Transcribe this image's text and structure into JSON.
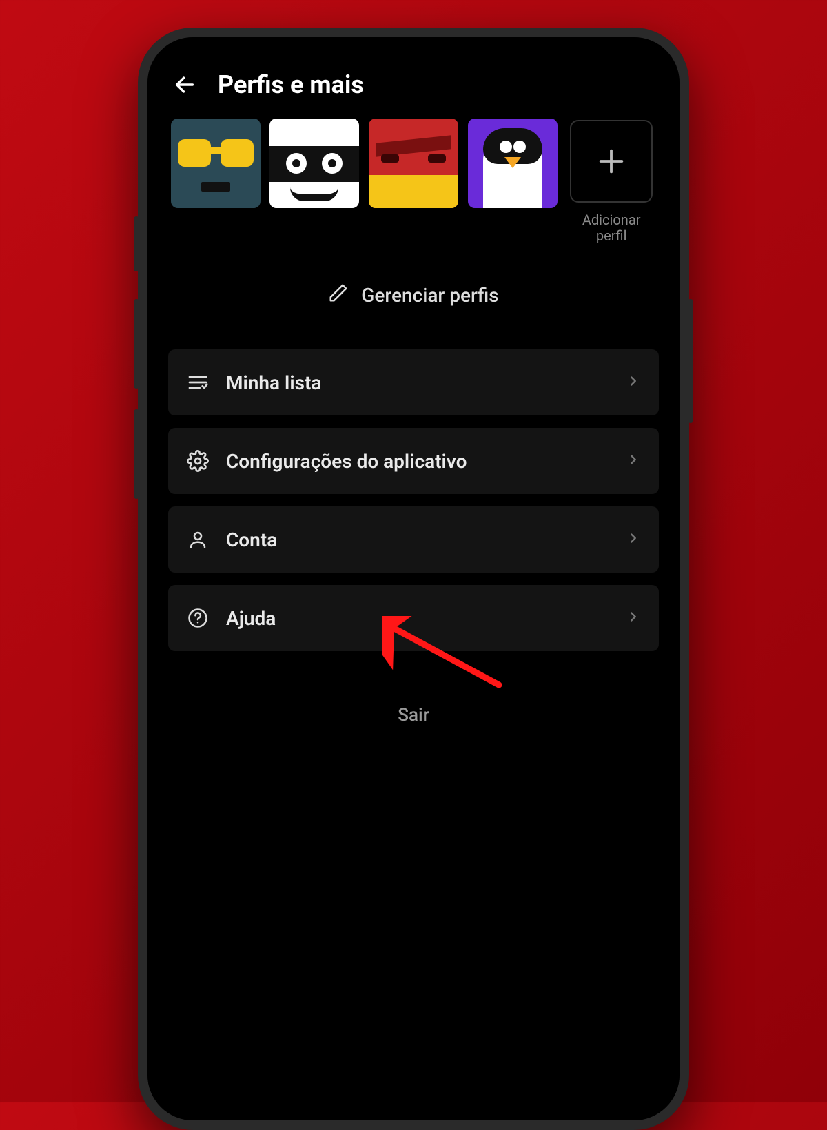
{
  "header": {
    "title": "Perfis e mais"
  },
  "profiles": {
    "add_label": "Adicionar perfil"
  },
  "manage_label": "Gerenciar perfis",
  "menu": {
    "my_list": "Minha lista",
    "app_settings": "Configurações do aplicativo",
    "account": "Conta",
    "help": "Ajuda"
  },
  "signout_label": "Sair",
  "colors": {
    "background": "#b00910",
    "surface": "#141414",
    "text": "#eaeaea",
    "muted": "#8a8a8a",
    "annotation": "#ff1717"
  },
  "annotation": {
    "points_to": "account",
    "shape": "arrow"
  }
}
